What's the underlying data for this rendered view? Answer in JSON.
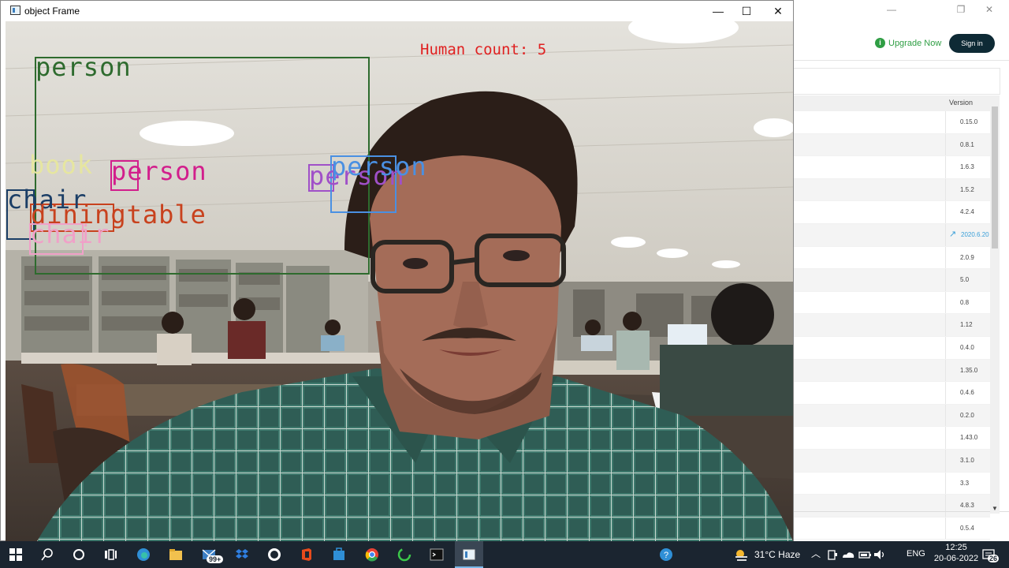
{
  "camera_window": {
    "title": "object Frame",
    "controls": {
      "minimize": "—",
      "maximize": "☐",
      "close": "✕"
    },
    "human_count_text": "Human count: 5",
    "detections": [
      {
        "label": "person",
        "color": "#2e6b2e"
      },
      {
        "label": "book",
        "color": "#e6e6a0"
      },
      {
        "label": "person",
        "color": "#d21e8c"
      },
      {
        "label": "chair",
        "color": "#1b3e66"
      },
      {
        "label": "diningtable",
        "color": "#c8421e"
      },
      {
        "label": "chair",
        "color": "#f0a0c8"
      },
      {
        "label": "person",
        "color": "#a050c8"
      },
      {
        "label": "person",
        "color": "#4a90e2"
      }
    ]
  },
  "background_app": {
    "window_controls": {
      "minimize": "—",
      "maximize": "❐",
      "close": "✕"
    },
    "upgrade_label": "Upgrade Now",
    "signin_label": "Sign in",
    "table_header": "Version",
    "versions": [
      "0.15.0",
      "0.8.1",
      "1.6.3",
      "1.5.2",
      "4.2.4",
      "2020.6.20",
      "2.0.9",
      "5.0",
      "0.8",
      "1.12",
      "0.4.0",
      "1.35.0",
      "0.4.6",
      "0.2.0",
      "1.43.0",
      "3.1.0",
      "3.3",
      "4.8.3",
      "0.5.4"
    ],
    "link_row_index": 5
  },
  "taskbar": {
    "badge_mail": "99+",
    "weather": "31°C  Haze",
    "language": "ENG",
    "time": "12:25",
    "date": "20-06-2022",
    "notifications": "26"
  }
}
